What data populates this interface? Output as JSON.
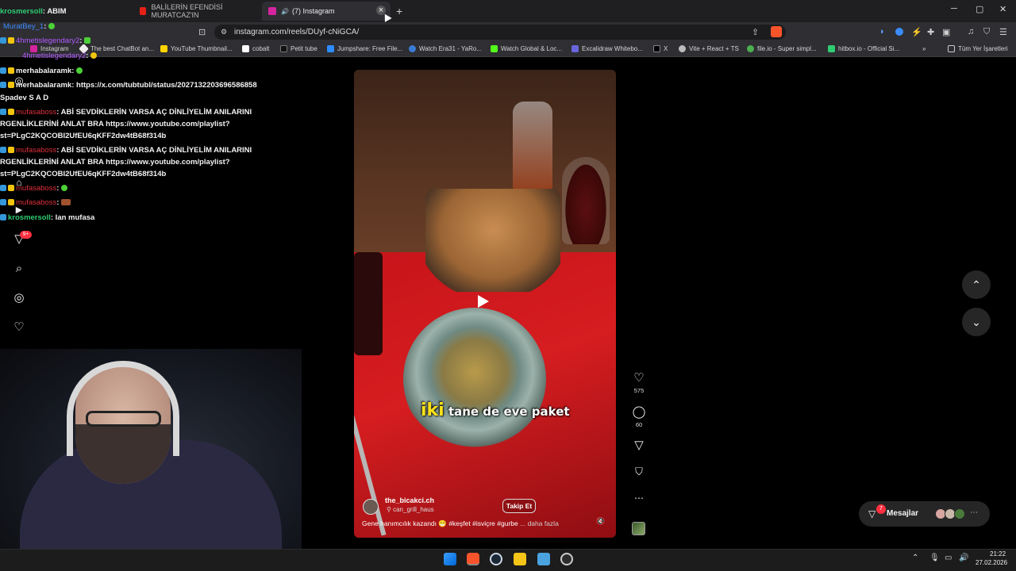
{
  "browser": {
    "tabs": [
      {
        "label": "BALİLERİN EFENDİSİ MURATCAZ'IN",
        "active": false,
        "favicon_color": "#e62117"
      },
      {
        "label": "(7) Instagram",
        "active": true,
        "favicon_color": "#d6249f"
      }
    ],
    "new_tab_label": "+",
    "window_controls": {
      "minimize": "─",
      "maximize": "▢",
      "close": "✕"
    },
    "url": "instagram.com/reels/DUyf-cNiGCA/",
    "bookmarks": [
      {
        "label": "Instagram",
        "color": "#d6249f"
      },
      {
        "label": "The best ChatBot an...",
        "color": "#eeeeee"
      },
      {
        "label": "YouTube Thumbnail...",
        "color": "#ffd400"
      },
      {
        "label": "cobalt",
        "color": "#ffffff"
      },
      {
        "label": "Petit tube",
        "color": "#111111"
      },
      {
        "label": "Jumpshare: Free File...",
        "color": "#2d8cff"
      },
      {
        "label": "Watch Era31 - YaRo...",
        "color": "#3a7bd5"
      },
      {
        "label": "Watch Global & Loc...",
        "color": "#53fc18"
      },
      {
        "label": "Excalidraw Whitebo...",
        "color": "#6965db"
      },
      {
        "label": "X",
        "color": "#000000"
      },
      {
        "label": "Vite + React + TS",
        "color": "#bbbbbb"
      },
      {
        "label": "file.io - Super simpl...",
        "color": "#4caf50"
      },
      {
        "label": "hitbox.io - Official Si...",
        "color": "#2ecc71"
      }
    ],
    "bookmarks_more": "»",
    "all_bookmarks": "Tüm Yer İşaretleri"
  },
  "chat": [
    {
      "user": "krosmersoll",
      "msg": ": ABIM",
      "color_class": "u-green"
    },
    {
      "user": "MuratBey_1",
      "msg": ":",
      "color_class": "u-blue"
    },
    {
      "user": "4hmetislegendary2",
      "msg": ":",
      "color_class": "u-purple"
    },
    {
      "user": "4hmetislegendary2",
      "msg": ":",
      "color_class": "u-purple"
    },
    {
      "user": "merhabalaramk",
      "msg": ":",
      "color_class": ""
    },
    {
      "user": "merhabalaramk",
      "msg": ": https://x.com/tubtubl/status/2027132203696586858",
      "color_class": ""
    },
    {
      "user": "",
      "msg": "Spadev S A D",
      "color_class": ""
    },
    {
      "user": "mufasaboss",
      "msg": ": ABİ SEVDİKLERİN VARSA AÇ DİNLİYELİM ANILARINI",
      "color_class": "u-red"
    },
    {
      "user": "",
      "msg": "RGENLİKLERİNİ ANLAT BRA https://www.youtube.com/playlist?",
      "color_class": ""
    },
    {
      "user": "",
      "msg": "st=PLgC2KQCOBI2UfEU6qKFF2dw4tB68f314b",
      "color_class": ""
    },
    {
      "user": "mufasaboss",
      "msg": ": ABİ SEVDİKLERİN VARSA AÇ DİNLİYELİM ANILARINI",
      "color_class": "u-red"
    },
    {
      "user": "",
      "msg": "RGENLİKLERİNİ ANLAT BRA https://www.youtube.com/playlist?",
      "color_class": ""
    },
    {
      "user": "",
      "msg": "st=PLgC2KQCOBI2UfEU6qKFF2dw4tB68f314b",
      "color_class": ""
    },
    {
      "user": "mufasaboss",
      "msg": ":",
      "color_class": "u-red"
    },
    {
      "user": "mufasaboss",
      "msg": ":",
      "color_class": "u-red"
    },
    {
      "user": "krosmersoll",
      "msg": ": lan mufasa",
      "color_class": "u-green"
    }
  ],
  "instagram": {
    "notifications_badge": "9+",
    "reel": {
      "overlay_highlight": "iki",
      "overlay_text": " tane de eve paket",
      "author": "the_bicakci.ch",
      "audio": "can_grill_haus",
      "follow_label": "Takip Et",
      "caption": "Gene hanımcılık kazandı 😁 #keşfet #isviçre #gurbe",
      "caption_more": "... daha fazla"
    },
    "likes": "575",
    "comments": "60",
    "more_label": "⋯",
    "messages_label": "Mesajlar",
    "messages_count": "7"
  },
  "taskbar": {
    "time": "21:22",
    "date": "27.02.2026"
  }
}
